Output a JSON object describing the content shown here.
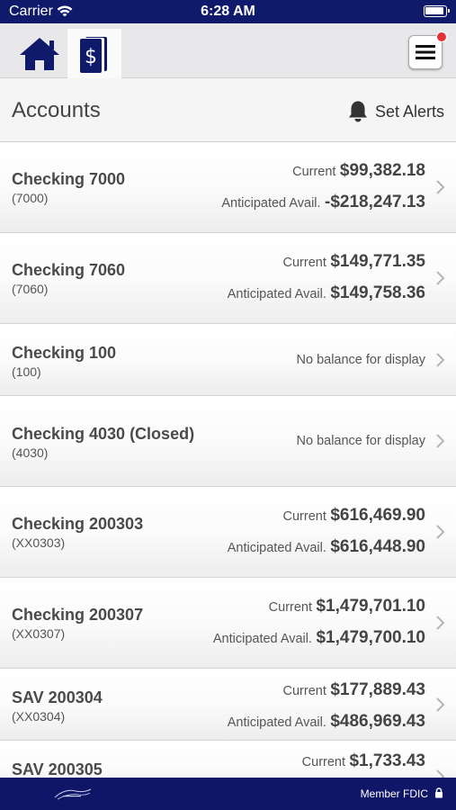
{
  "status_bar": {
    "carrier": "Carrier",
    "time": "6:28 AM"
  },
  "nav": {
    "tabs": [
      {
        "name": "home",
        "icon": "home-icon"
      },
      {
        "name": "accounts",
        "icon": "accounts-dollar-icon"
      }
    ],
    "menu_icon": "hamburger-menu-icon"
  },
  "header": {
    "title": "Accounts",
    "set_alerts_label": "Set Alerts",
    "bell_icon": "bell-icon"
  },
  "accounts": [
    {
      "name": "Checking 7000",
      "number": "(7000)",
      "current_label": "Current",
      "current": "$99,382.18",
      "anticipated_label": "Anticipated Avail.",
      "anticipated": "-$218,247.13"
    },
    {
      "name": "Checking 7060",
      "number": "(7060)",
      "current_label": "Current",
      "current": "$149,771.35",
      "anticipated_label": "Anticipated Avail.",
      "anticipated": "$149,758.36"
    },
    {
      "name": "Checking 100",
      "number": "(100)",
      "no_balance": "No balance for display"
    },
    {
      "name": "Checking 4030 (Closed)",
      "number": "(4030)",
      "no_balance": "No balance for display"
    },
    {
      "name": "Checking 200303",
      "number": "(XX0303)",
      "current_label": "Current",
      "current": "$616,469.90",
      "anticipated_label": "Anticipated Avail.",
      "anticipated": "$616,448.90"
    },
    {
      "name": "Checking 200307",
      "number": "(XX0307)",
      "current_label": "Current",
      "current": "$1,479,701.10",
      "anticipated_label": "Anticipated Avail.",
      "anticipated": "$1,479,700.10"
    },
    {
      "name": "SAV 200304",
      "number": "(XX0304)",
      "current_label": "Current",
      "current": "$177,889.43",
      "anticipated_label": "Anticipated Avail.",
      "anticipated": "$486,969.43"
    },
    {
      "name": "SAV 200305",
      "current_label": "Current",
      "current": "$1,733.43"
    }
  ],
  "footer": {
    "member_fdic": "Member FDIC",
    "lock_icon": "lock-icon"
  },
  "colors": {
    "brand_navy": "#101a6b",
    "footer_navy": "#0f1668",
    "notification_red": "#e5323a"
  }
}
